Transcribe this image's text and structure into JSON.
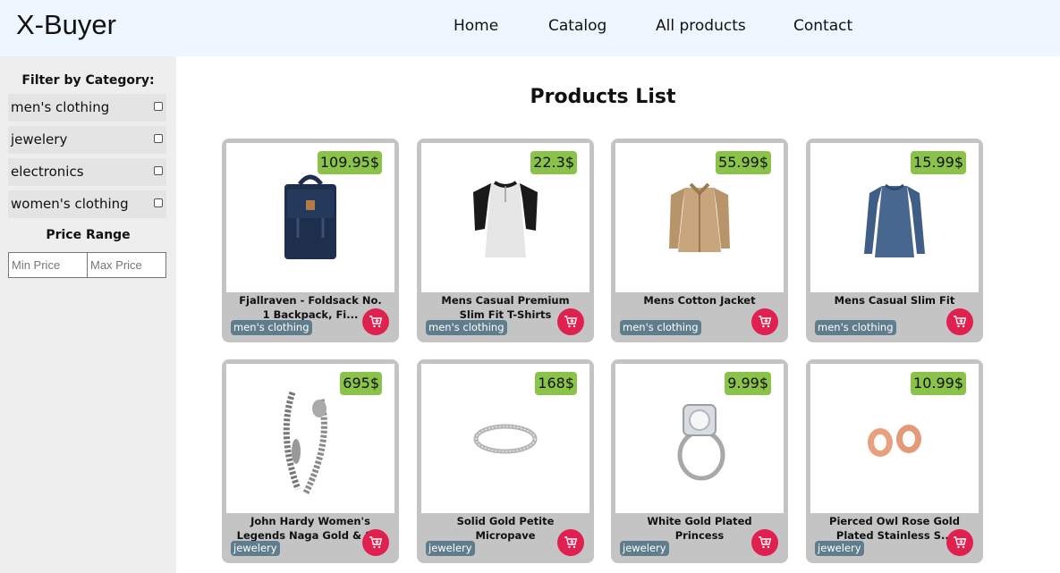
{
  "navbar": {
    "brand": "X-Buyer",
    "links": [
      "Home",
      "Catalog",
      "All products",
      "Contact"
    ]
  },
  "sidebar": {
    "filter_title": "Filter by Category:",
    "categories": [
      "men's clothing",
      "jewelery",
      "electronics",
      "women's clothing"
    ],
    "range_title": "Price Range",
    "min_placeholder": "Min Price",
    "max_placeholder": "Max Price"
  },
  "main": {
    "title": "Products List",
    "products": [
      {
        "name": "Fjallraven - Foldsack No. 1 Backpack, Fi...",
        "price": "109.95$",
        "category": "men's clothing",
        "image": "backpack"
      },
      {
        "name": "Mens Casual Premium Slim Fit T-Shirts",
        "price": "22.3$",
        "category": "men's clothing",
        "image": "raglan-shirt"
      },
      {
        "name": "Mens Cotton Jacket",
        "price": "55.99$",
        "category": "men's clothing",
        "image": "jacket"
      },
      {
        "name": "Mens Casual Slim Fit",
        "price": "15.99$",
        "category": "men's clothing",
        "image": "long-sleeve-shirt"
      },
      {
        "name": "John Hardy Women's Legends Naga Gold & S...",
        "price": "695$",
        "category": "jewelery",
        "image": "dragon-bracelet"
      },
      {
        "name": "Solid Gold Petite Micropave",
        "price": "168$",
        "category": "jewelery",
        "image": "ring"
      },
      {
        "name": "White Gold Plated Princess",
        "price": "9.99$",
        "category": "jewelery",
        "image": "diamond-ring"
      },
      {
        "name": "Pierced Owl Rose Gold Plated Stainless S...",
        "price": "10.99$",
        "category": "jewelery",
        "image": "plugs"
      }
    ]
  },
  "colors": {
    "navbar_bg": "#eef6ff",
    "sidebar_bg": "#eeeeee",
    "card_bg": "#c4c4c4",
    "price_badge": "#8bc34a",
    "category_tag": "#5f7d8d",
    "cart_button": "#e0204f"
  },
  "icons": {
    "cart": "add-to-cart-icon"
  }
}
